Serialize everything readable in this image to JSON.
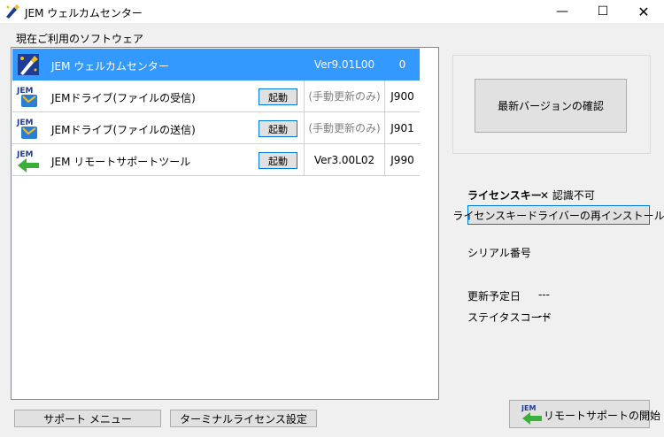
{
  "window": {
    "title": "JEM ウェルカムセンター",
    "minimize_glyph": "—",
    "maximize_glyph": "☐",
    "close_glyph": "✕"
  },
  "main": {
    "section_label": "現在ご利用のソフトウェア",
    "rows": [
      {
        "name": "JEM ウェルカムセンター",
        "version": "Ver9.01L00",
        "code": "0",
        "icon": "jem-wizard-icon"
      },
      {
        "name": "JEMドライブ(ファイルの受信)",
        "launch_label": "起動",
        "version": "(手動更新のみ)",
        "code": "J900",
        "icon": "jem-drive-icon"
      },
      {
        "name": "JEMドライブ(ファイルの送信)",
        "launch_label": "起動",
        "version": "(手動更新のみ)",
        "code": "J901",
        "icon": "jem-drive-icon"
      },
      {
        "name": "JEM リモートサポートツール",
        "launch_label": "起動",
        "version": "Ver3.00L02",
        "code": "J990",
        "icon": "jem-remote-icon"
      }
    ]
  },
  "bottom": {
    "support_menu_label": "サポート メニュー",
    "terminal_license_label": "ターミナルライセンス設定"
  },
  "update": {
    "check_label": "最新バージョンの確認"
  },
  "license": {
    "key_label": "ライセンスキー",
    "status": "✕ 認識不可",
    "reinstall_label": "ライセンスキードライバーの再インストール"
  },
  "info": {
    "serial_label": "シリアル番号",
    "renewal_label": "更新予定日",
    "renewal_value": "---",
    "status_code_label": "ステイタスコード",
    "status_code_value": "---"
  },
  "remote": {
    "start_label": "リモートサポートの開始",
    "icon_text": "JEM"
  },
  "colors": {
    "selection": "#3399ff",
    "focus_border": "#0078d7",
    "jem_blue": "#1e3c96"
  }
}
